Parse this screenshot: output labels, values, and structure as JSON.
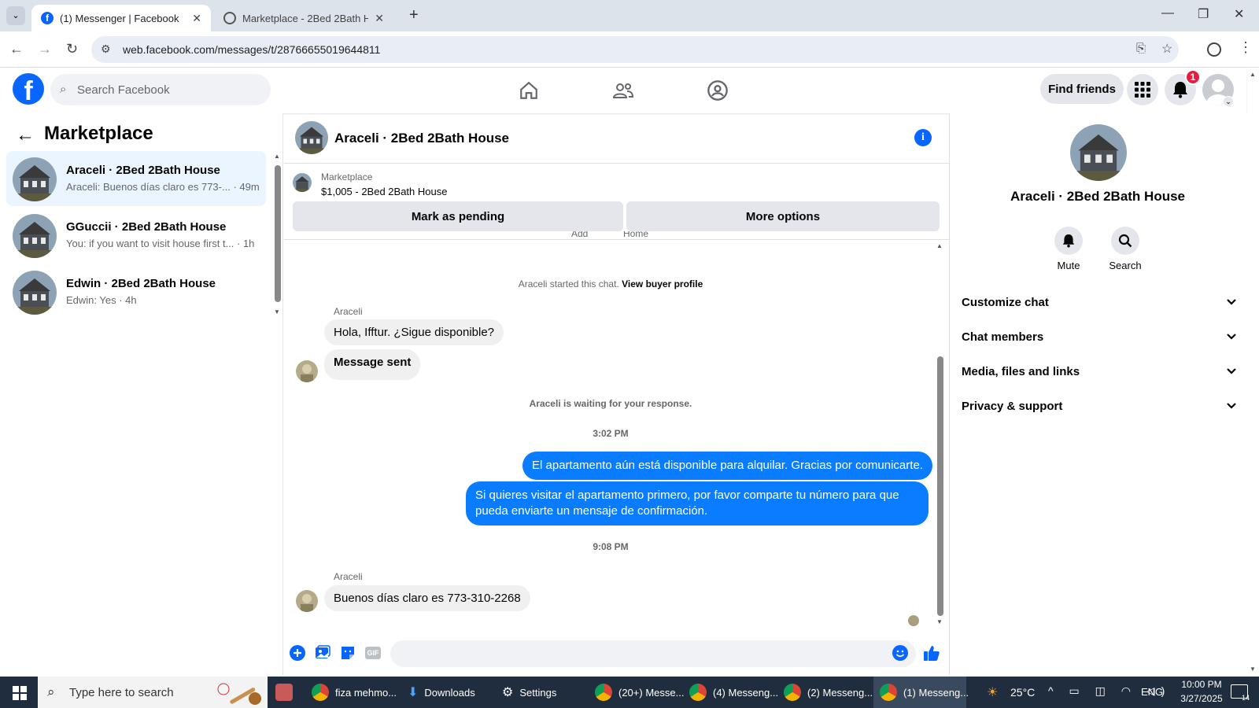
{
  "browser": {
    "tabs": [
      {
        "title": "(1) Messenger | Facebook",
        "active": true
      },
      {
        "title": "Marketplace - 2Bed 2Bath Hous",
        "active": false
      }
    ],
    "url": "web.facebook.com/messages/t/28766655019644811"
  },
  "header": {
    "search_placeholder": "Search Facebook",
    "find_friends": "Find friends",
    "notification_count": "1"
  },
  "sidebar": {
    "title": "Marketplace",
    "conversations": [
      {
        "name": "Araceli · 2Bed 2Bath House",
        "preview": "Araceli: Buenos días claro es 773-... · 49m"
      },
      {
        "name": "GGuccii · 2Bed 2Bath House",
        "preview": "You: if you want to visit house first t... · 1h"
      },
      {
        "name": "Edwin · 2Bed 2Bath House",
        "preview": "Edwin: Yes · 4h"
      }
    ]
  },
  "chat": {
    "title": "Araceli · 2Bed 2Bath House",
    "marketplace_label": "Marketplace",
    "listing": "$1,005 - 2Bed 2Bath House",
    "mark_pending": "Mark as pending",
    "more_options": "More options",
    "cut_text_1": "Add",
    "cut_text_2": "Home",
    "started_text": "Araceli started this chat.",
    "view_buyer": "View buyer profile",
    "sender1": "Araceli",
    "msg1": "Hola, Ifftur. ¿Sigue disponible?",
    "msg2": "Message sent",
    "waiting": "Araceli is waiting for your response.",
    "time1": "3:02 PM",
    "out1": "El apartamento aún está disponible para alquilar. Gracias por comunicarte.",
    "out2": "Si quieres visitar el apartamento primero, por favor comparte tu número para que pueda enviarte un mensaje de confirmación.",
    "time2": "9:08 PM",
    "sender2": "Araceli",
    "msg3": "Buenos días claro es 773-310-2268"
  },
  "info_panel": {
    "name": "Araceli · 2Bed 2Bath House",
    "mute": "Mute",
    "search": "Search",
    "rows": [
      "Customize chat",
      "Chat members",
      "Media, files and links",
      "Privacy & support"
    ]
  },
  "taskbar": {
    "search_placeholder": "Type here to search",
    "apps": [
      "fiza mehmo...",
      "Downloads",
      "Settings",
      "(20+) Messe...",
      "(4) Messeng...",
      "(2) Messeng...",
      "(1) Messeng..."
    ],
    "temp": "25°C",
    "lang": "ENG",
    "time": "10:00 PM",
    "date": "3/27/2025",
    "notif": "14"
  },
  "colors": {
    "fb_blue": "#0866ff",
    "bubble_out": "#0a7cff"
  }
}
